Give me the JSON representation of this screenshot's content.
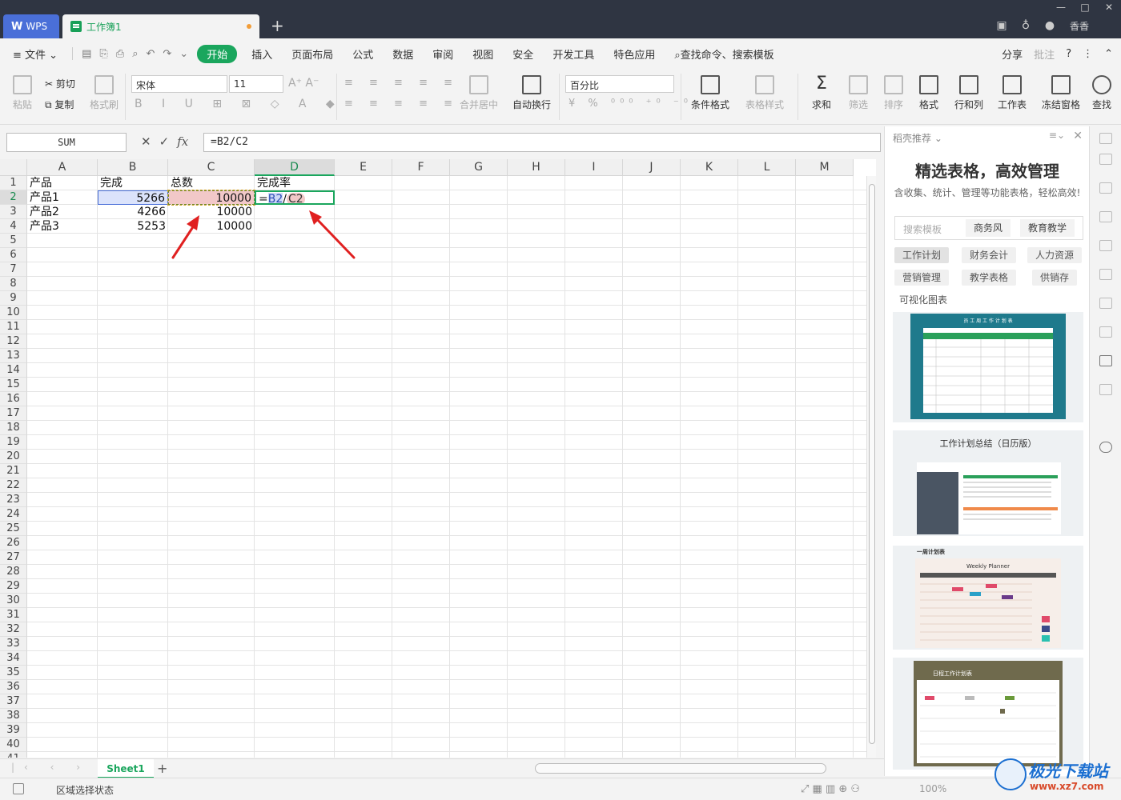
{
  "titlebar": {
    "wps_tab": "WPS",
    "doc_tab": "工作簿1",
    "user": "香香"
  },
  "menubar": {
    "file": "文件",
    "tabs": [
      "开始",
      "插入",
      "页面布局",
      "公式",
      "数据",
      "审阅",
      "视图",
      "安全",
      "开发工具",
      "特色应用"
    ],
    "active_tab": "开始",
    "search": "查找命令、搜索模板",
    "share": "分享",
    "comment": "批注"
  },
  "ribbon": {
    "paste": "粘贴",
    "cut": "剪切",
    "copy": "复制",
    "format_painter": "格式刷",
    "font_name": "宋体",
    "font_size": "11",
    "number_format": "百分比",
    "merge_center": "合并居中",
    "wrap_text": "自动换行",
    "conditional_format": "条件格式",
    "table_style": "表格样式",
    "sum": "求和",
    "filter": "筛选",
    "sort": "排序",
    "format": "格式",
    "row_col": "行和列",
    "worksheet": "工作表",
    "freeze": "冻结窗格",
    "find": "查找"
  },
  "formulabar": {
    "name_box": "SUM",
    "formula": "=B2/C2"
  },
  "sheet": {
    "columns": [
      "A",
      "B",
      "C",
      "D",
      "E",
      "F",
      "G",
      "H",
      "I",
      "J",
      "K",
      "L",
      "M"
    ],
    "active_column": "D",
    "active_row": 2,
    "row_count": 41,
    "rows": [
      [
        "产品",
        "完成",
        "总数",
        "完成率"
      ],
      [
        "产品1",
        "5266",
        "10000",
        "=B2/C2"
      ],
      [
        "产品2",
        "4266",
        "10000",
        ""
      ],
      [
        "产品3",
        "5253",
        "10000",
        ""
      ]
    ],
    "formula_parts": {
      "eq": "=",
      "ref1": "B2",
      "op": "/",
      "ref2": "C2"
    }
  },
  "sheet_tabs": {
    "active": "Sheet1"
  },
  "status": {
    "text": "区域选择状态",
    "zoom": "100%"
  },
  "panel": {
    "header": "稻壳推荐",
    "title": "精选表格，高效管理",
    "subtitle": "含收集、统计、管理等功能表格，轻松高效!",
    "search_placeholder": "搜索模板",
    "keywords": [
      "商务风",
      "教育教学"
    ],
    "categories": [
      "工作计划",
      "财务会计",
      "人力资源",
      "营销管理",
      "教学表格",
      "供销存",
      "可视化图表"
    ],
    "templates": [
      {
        "title": "员 工 周 工 作 计 划 表",
        "color": "#1f7a8c"
      },
      {
        "title": "工作计划总结（日历版）",
        "color": "#e8ecef"
      },
      {
        "title": "一周计划表",
        "subtitle": "Weekly Planner",
        "color": "#f6eee9"
      },
      {
        "title": "日程工作计划表",
        "color": "#6f6a4d"
      }
    ]
  },
  "watermark": {
    "brand": "极光下载站",
    "url": "www.xz7.com"
  }
}
